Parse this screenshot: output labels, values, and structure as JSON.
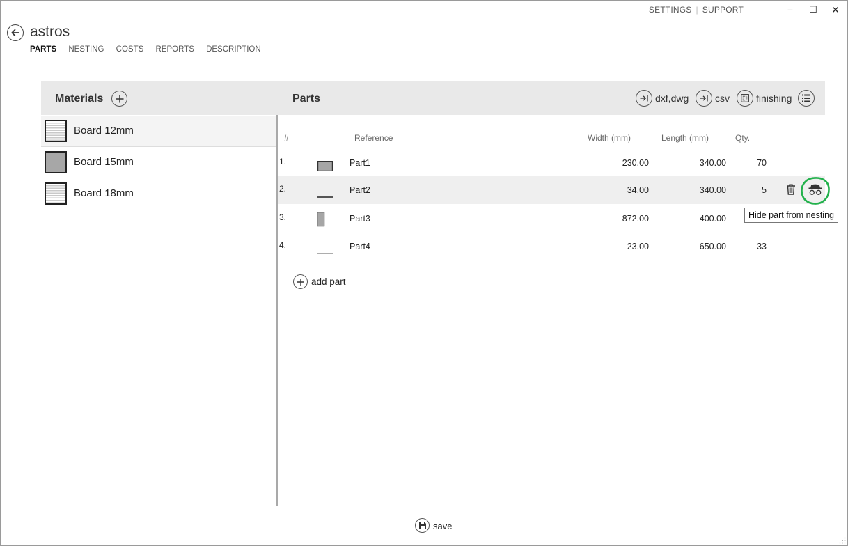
{
  "topbar": {
    "settings": "SETTINGS",
    "separator": "|",
    "support": "SUPPORT"
  },
  "window_controls": {
    "minimize": "−",
    "maximize": "☐",
    "close": "✕"
  },
  "header": {
    "title": "astros"
  },
  "nav": {
    "tabs": [
      {
        "label": "PARTS",
        "active": true
      },
      {
        "label": "NESTING"
      },
      {
        "label": "COSTS"
      },
      {
        "label": "REPORTS"
      },
      {
        "label": "DESCRIPTION"
      }
    ]
  },
  "materials": {
    "title": "Materials",
    "items": [
      {
        "label": "Board 12mm",
        "swatch": "striped",
        "selected": true
      },
      {
        "label": "Board 15mm",
        "swatch": "solid"
      },
      {
        "label": "Board 18mm",
        "swatch": "striped"
      }
    ]
  },
  "parts": {
    "title": "Parts",
    "actions": {
      "dxf": "dxf,dwg",
      "csv": "csv",
      "finishing": "finishing"
    },
    "columns": {
      "num": "#",
      "reference": "Reference",
      "width": "Width (mm)",
      "length": "Length (mm)",
      "qty": "Qty."
    },
    "rows": [
      {
        "num": "1.",
        "reference": "Part1",
        "width": "230.00",
        "length": "340.00",
        "qty": "70"
      },
      {
        "num": "2.",
        "reference": "Part2",
        "width": "34.00",
        "length": "340.00",
        "qty": "5"
      },
      {
        "num": "3.",
        "reference": "Part3",
        "width": "872.00",
        "length": "400.00",
        "qty": ""
      },
      {
        "num": "4.",
        "reference": "Part4",
        "width": "23.00",
        "length": "650.00",
        "qty": "33"
      }
    ],
    "add_part": "add part",
    "tooltip": "Hide part from nesting"
  },
  "footer": {
    "save": "save"
  },
  "colors": {
    "highlight_circle": "#22b14c",
    "panel_header": "#e9e9e9",
    "divider": "#a9a9a9"
  }
}
